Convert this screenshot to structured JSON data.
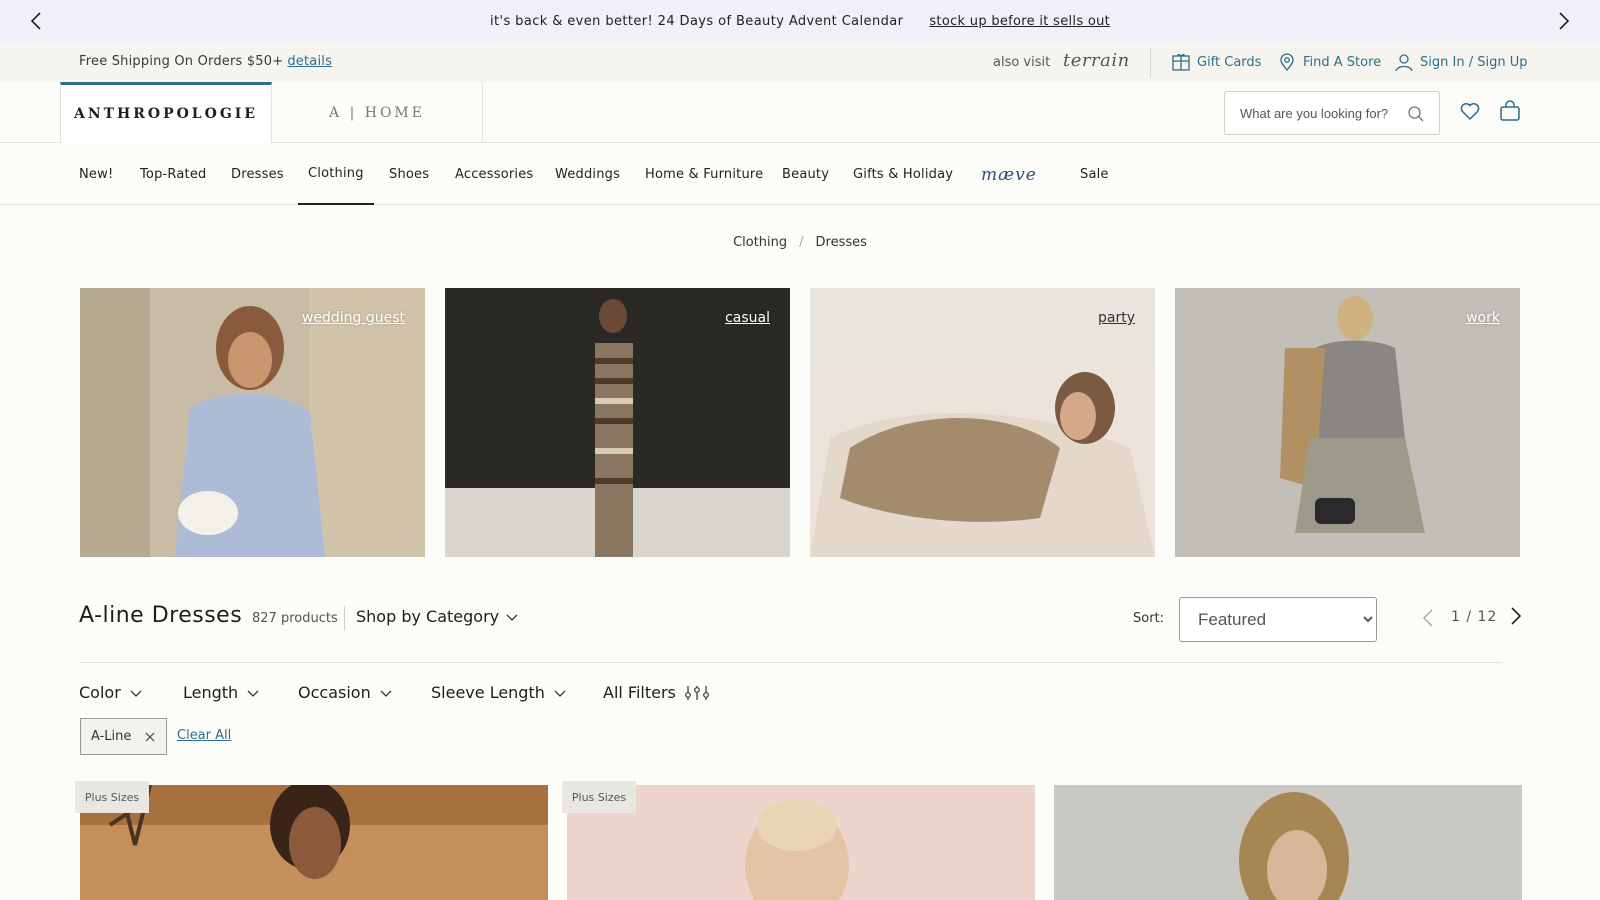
{
  "promo": {
    "message": "it's back & even better! 24 Days of Beauty Advent Calendar",
    "link": "stock up before it sells out"
  },
  "utility": {
    "shipping_text": "Free Shipping On Orders $50+",
    "shipping_link": "details",
    "also_visit": "also visit",
    "terrain": "terrain",
    "gift_cards": "Gift Cards",
    "find_store": "Find A Store",
    "sign_in": "Sign In / Sign Up"
  },
  "header": {
    "brand_anthropologie": "ANTHROPOLOGIE",
    "brand_home": "A | HOME",
    "search_placeholder": "What are you looking for?"
  },
  "nav": {
    "items": [
      "New!",
      "Top-Rated",
      "Dresses",
      "Clothing",
      "Shoes",
      "Accessories",
      "Weddings",
      "Home & Furniture",
      "Beauty",
      "Gifts & Holiday",
      "mæve",
      "Sale"
    ],
    "active": "Clothing"
  },
  "breadcrumb": [
    "Clothing",
    "/",
    "Dresses"
  ],
  "tiles": [
    "wedding guest",
    "casual",
    "party",
    "work"
  ],
  "results": {
    "title": "A-line Dresses",
    "count": "827 products",
    "shop_by_category": "Shop by Category",
    "sort_label": "Sort:",
    "sort_value": "Featured",
    "page_current": "1",
    "page_total": "12",
    "page_text": "1 / 12"
  },
  "filters": {
    "items": [
      "Color",
      "Length",
      "Occasion",
      "Sleeve Length",
      "All Filters"
    ],
    "active_chip": "A-Line",
    "clear_all": "Clear All"
  },
  "products": {
    "badges": [
      "Plus Sizes",
      "Plus Sizes"
    ]
  },
  "colors": {
    "accent": "#2f6d8f",
    "promo_bg": "#f1eff7",
    "page_bg": "#fcfcf8"
  }
}
